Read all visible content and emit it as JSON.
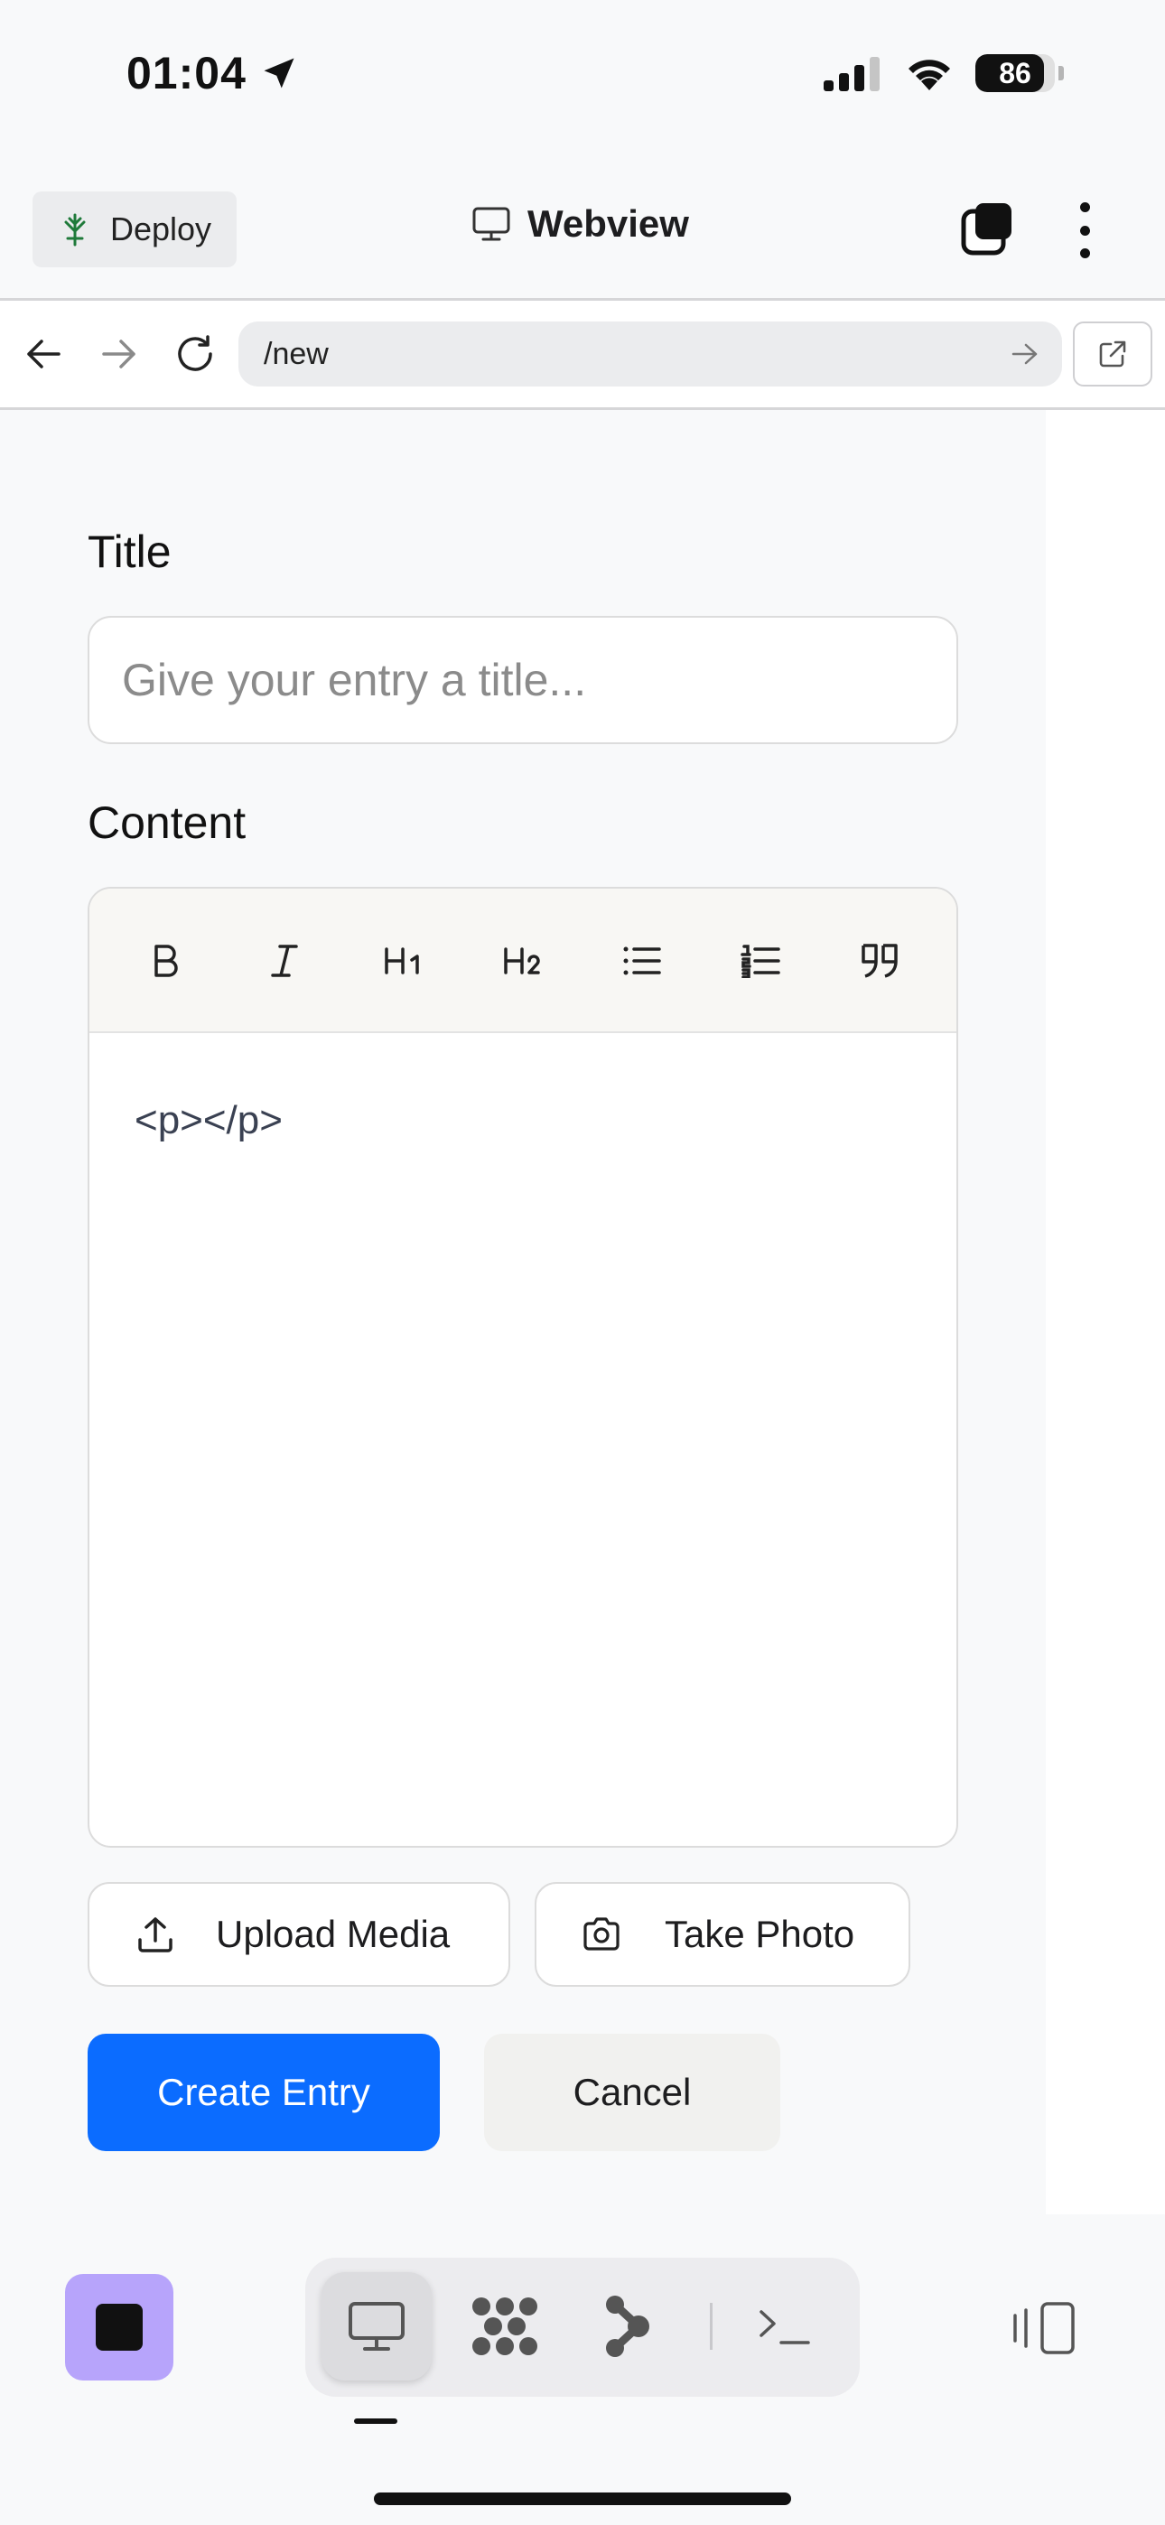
{
  "status_bar": {
    "time": "01:04",
    "battery": "86",
    "battery_level": 0.86
  },
  "header": {
    "deploy_label": "Deploy",
    "title": "Webview"
  },
  "nav": {
    "url": "/new"
  },
  "form": {
    "title_label": "Title",
    "title_placeholder": "Give your entry a title...",
    "title_value": "",
    "content_label": "Content",
    "toolbar": [
      "B",
      "I",
      "H1",
      "H2",
      "bulleted-list",
      "numbered-list",
      "quote"
    ],
    "editor_content": "<p></p>",
    "upload_label": "Upload Media",
    "photo_label": "Take Photo",
    "create_label": "Create Entry",
    "cancel_label": "Cancel"
  },
  "bottom_bar": {
    "items": [
      "webview",
      "extensions",
      "workflows",
      "console"
    ],
    "active": "webview"
  },
  "colors": {
    "accent": "#0b6cff",
    "stop": "#b7a4fb"
  }
}
